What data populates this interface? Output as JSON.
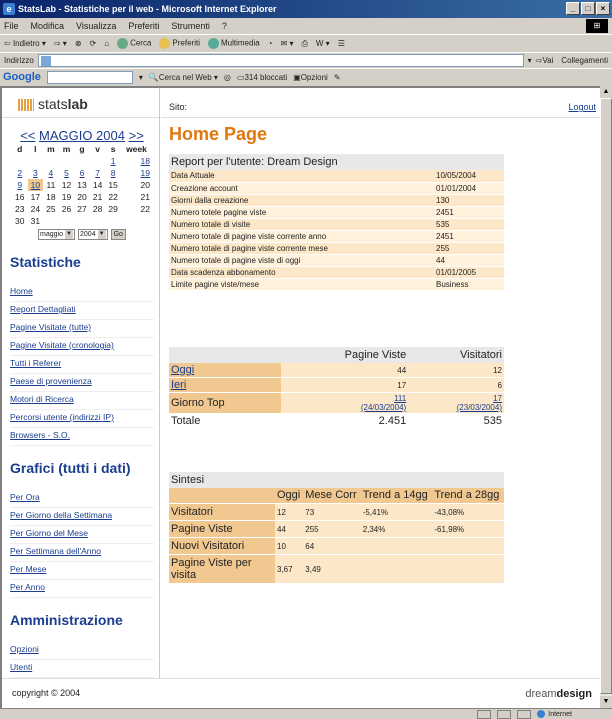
{
  "window": {
    "title": "StatsLab - Statistiche per il web - Microsoft Internet Explorer",
    "buttons": [
      "_",
      "□",
      "×"
    ]
  },
  "menubar": [
    "File",
    "Modifica",
    "Visualizza",
    "Preferiti",
    "Strumenti",
    "?"
  ],
  "toolbar": {
    "back": "Indietro",
    "search": "Cerca",
    "favorites": "Preferiti",
    "media": "Multimedia"
  },
  "addressbar": {
    "label": "Indirizzo",
    "go": "Vai",
    "links": "Collegamenti"
  },
  "googlebar": {
    "logo": "Google",
    "search_web": "Cerca nel Web",
    "blocked": "314 bloccati",
    "options": "Opzioni"
  },
  "statusbar": {
    "zone": "Internet"
  },
  "page": {
    "logo_light": "stats",
    "logo_bold": "lab",
    "site_label": "Sito:",
    "logout": "Logout",
    "heading": "Home Page",
    "calendar": {
      "prev": "<<",
      "month": "MAGGIO 2004",
      "next": ">>",
      "headers": [
        "d",
        "l",
        "m",
        "m",
        "g",
        "v",
        "s",
        "week"
      ],
      "rows": [
        [
          "",
          "",
          "",
          "",
          "",
          "",
          "1",
          "18"
        ],
        [
          "2",
          "3",
          "4",
          "5",
          "6",
          "7",
          "8",
          "19"
        ],
        [
          "9",
          "10",
          "11",
          "12",
          "13",
          "14",
          "15",
          "20"
        ],
        [
          "16",
          "17",
          "18",
          "19",
          "20",
          "21",
          "22",
          "21"
        ],
        [
          "23",
          "24",
          "25",
          "26",
          "27",
          "28",
          "29",
          "22"
        ],
        [
          "30",
          "31",
          "",
          "",
          "",
          "",
          "",
          ""
        ]
      ],
      "month_select": "maggio",
      "year_select": "2004",
      "go": "Go"
    },
    "stats_title": "Statistiche",
    "stats_links": [
      "Home",
      "Report Dettagliati",
      "Pagine Visitate (tutte)",
      "Pagine Visitate (cronologia)",
      "Tutti i Referer",
      "Paese di provenienza",
      "Motori di Ricerca",
      "Percorsi utente (indirizzi IP)",
      "Browsers - S.O."
    ],
    "graphs_title": "Grafici (tutti i dati)",
    "graphs_links": [
      "Per Ora",
      "Per Giorno della Settimana",
      "Per Giorno del Mese",
      "Per Settimana dell'Anno",
      "Per Mese",
      "Per Anno"
    ],
    "admin_title": "Amministrazione",
    "admin_links": [
      "Opzioni",
      "Utenti"
    ],
    "copyright": "copyright © 2004",
    "brand_light": "dream",
    "brand_bold": "design",
    "report": {
      "title": "Report per l'utente: Dream Design",
      "rows": [
        [
          "Data Attuale",
          "10/05/2004"
        ],
        [
          "Creazione account",
          "01/01/2004"
        ],
        [
          "Giorni dalla creazione",
          "130"
        ],
        [
          "Numero totele pagine viste",
          "2451"
        ],
        [
          "Numero totale di visite",
          "535"
        ],
        [
          "Numero totale di pagine viste corrente anno",
          "2451"
        ],
        [
          "Numero totale di pagine viste corrente mese",
          "255"
        ],
        [
          "Numero totale di pagine viste di oggi",
          "44"
        ],
        [
          "Data scadenza abbonamento",
          "01/01/2005"
        ],
        [
          "Limite pagine viste/mese",
          "Business"
        ]
      ]
    },
    "summary": {
      "col_pages": "Pagine Viste",
      "col_visitors": "Visitatori",
      "today_label": "Oggi",
      "today_pages": "44",
      "today_visitors": "12",
      "yesterday_label": "Ieri",
      "yesterday_pages": "17",
      "yesterday_visitors": "6",
      "topday_label": "Giorno Top",
      "topday_pages": "111",
      "topday_pages_date": "(24/03/2004)",
      "topday_visitors": "17",
      "topday_visitors_date": "(23/03/2004)",
      "total_label": "Totale",
      "total_pages": "2.451",
      "total_visitors": "535"
    },
    "sintesi": {
      "title": "Sintesi",
      "headers": [
        "",
        "Oggi",
        "Mese Corr",
        "Trend a 14gg",
        "Trend a 28gg"
      ],
      "rows": [
        [
          "Visitatori",
          "12",
          "73",
          "-5,41%",
          "-43,08%"
        ],
        [
          "Pagine Viste",
          "44",
          "255",
          "2,34%",
          "-61,98%"
        ],
        [
          "Nuovi Visitatori",
          "10",
          "64",
          "",
          ""
        ],
        [
          "Pagine Viste per visita",
          "3,67",
          "3,49",
          "",
          ""
        ]
      ]
    }
  }
}
